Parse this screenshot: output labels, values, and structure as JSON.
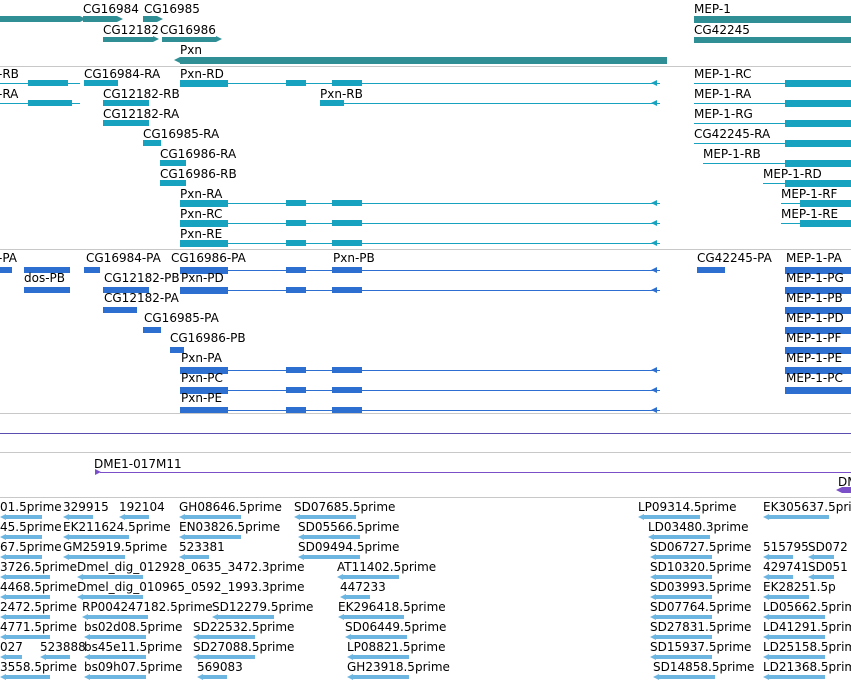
{
  "colors": {
    "gene": "#2f8f95",
    "transcript_a": "#17a2c0",
    "transcript_b": "#2d6fd1",
    "clone": "#7a4fc7",
    "est": "#6db6e2",
    "separator": "#c8c8c8",
    "range_line": "#5a4fb0"
  },
  "tracks": {
    "genes": {
      "labels": [
        "CG16984",
        "CG16985",
        "CG12182",
        "CG16986",
        "Pxn",
        "MEP-1",
        "CG42245"
      ]
    },
    "transcripts_a": {
      "labels": [
        "-RB",
        "-RA",
        "CG16984-RA",
        "Pxn-RD",
        "Pxn-RB",
        "CG12182-RB",
        "CG12182-RA",
        "CG16985-RA",
        "CG16986-RA",
        "CG16986-RB",
        "Pxn-RA",
        "Pxn-RC",
        "Pxn-RE",
        "MEP-1-RC",
        "MEP-1-RA",
        "MEP-1-RG",
        "CG42245-RA",
        "MEP-1-RB",
        "MEP-1-RD",
        "MEP-1-RF",
        "MEP-1-RE"
      ]
    },
    "transcripts_b": {
      "labels": [
        "-PA",
        "dos-PB",
        "CG16984-PA",
        "CG16986-PA",
        "Pxn-PB",
        "CG12182-PB",
        "Pxn-PD",
        "CG12182-PA",
        "CG16985-PA",
        "CG16986-PB",
        "Pxn-PA",
        "Pxn-PC",
        "Pxn-PE",
        "CG42245-PA",
        "MEP-1-PA",
        "MEP-1-PG",
        "MEP-1-PB",
        "MEP-1-PD",
        "MEP-1-PF",
        "MEP-1-PE",
        "MEP-1-PC"
      ]
    },
    "clones": {
      "labels": [
        "DME1-017M11",
        "DM"
      ]
    },
    "ests": {
      "labels": [
        "01.5prime",
        "329915",
        "192104",
        "GH08646.5prime",
        "SD07685.5prime",
        "LP09314.5prime",
        "EK305637.5prime",
        "45.5prime",
        "EK211624.5prime",
        "EN03826.5prime",
        "SD05566.5prime",
        "LD03480.3prime",
        "67.5prime",
        "GM25919.5prime",
        "523381",
        "SD09494.5prime",
        "SD06727.5prime",
        "515795",
        "SD072",
        "3726.5prime",
        "Dmel_dig_012928_0635_3472.3prime",
        "AT11402.5prime",
        "SD10320.5prime",
        "429741",
        "SD051",
        "4468.5prime",
        "Dmel_dig_010965_0592_1993.3prime",
        "447233",
        "SD03993.5prime",
        "EK28251.5p",
        "2472.5prime",
        "RP004247182.5prime",
        "SD12279.5prime",
        "EK296418.5prime",
        "SD07764.5prime",
        "LD05662.5prime",
        "4771.5prime",
        "bs02d08.5prime",
        "SD22532.5prime",
        "SD06449.5prime",
        "SD27831.5prime",
        "LD41291.5prime",
        "027",
        "523888",
        "bs45e11.5prime",
        "SD27088.5prime",
        "LP08821.5prime",
        "SD15937.5prime",
        "LD25158.5prime",
        "3558.5prime",
        "bs09h07.5prime",
        "569083",
        "GH23918.5prime",
        "SD14858.5prime",
        "LD21368.5prime"
      ]
    }
  }
}
